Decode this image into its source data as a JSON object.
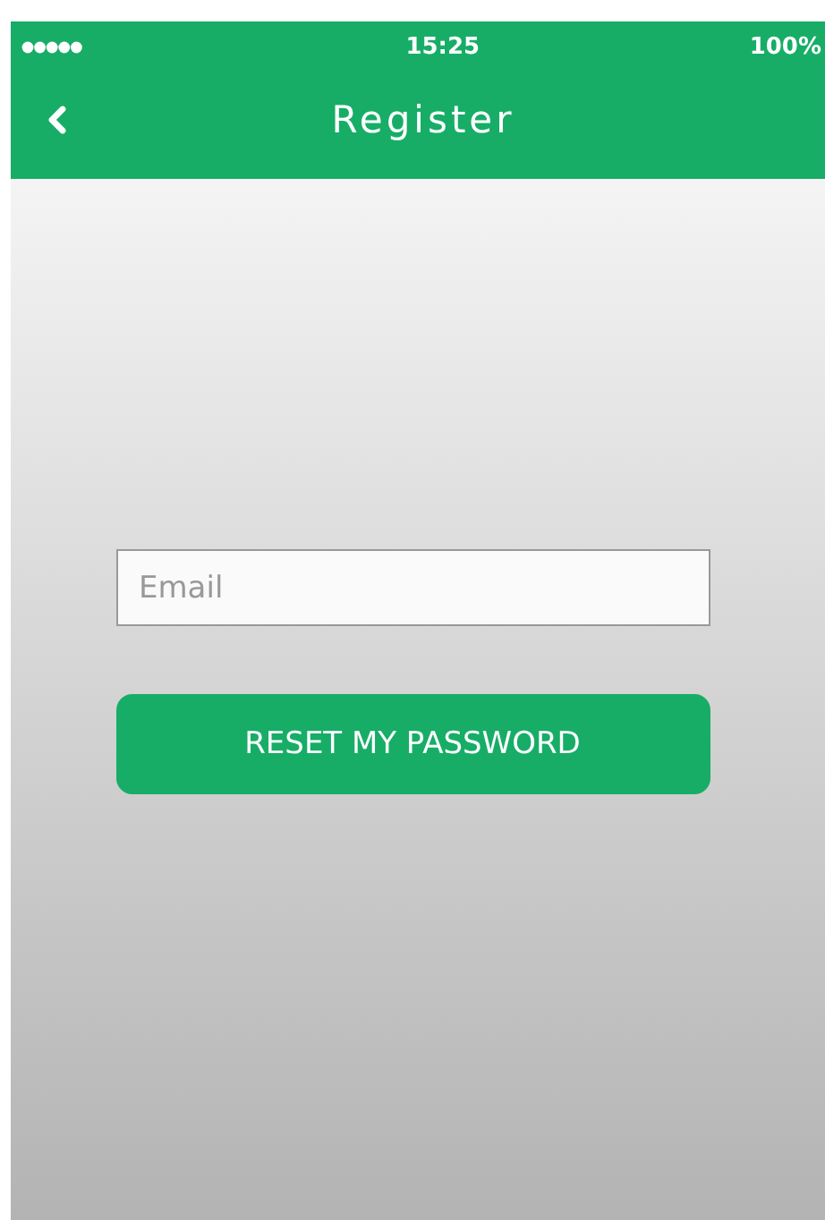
{
  "status_bar": {
    "time": "15:25",
    "battery": "100%"
  },
  "nav_bar": {
    "title": "Register"
  },
  "form": {
    "email": {
      "placeholder": "Email"
    },
    "button": "RESET MY PASSWORD"
  }
}
